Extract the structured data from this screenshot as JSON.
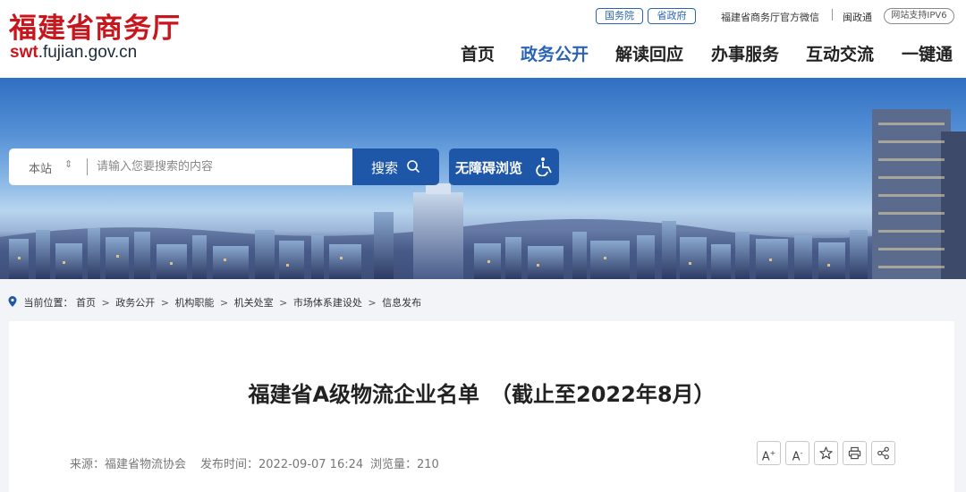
{
  "header": {
    "logo_cn": "福建省商务厅",
    "logo_url_prefix": "swt",
    "logo_url_suffix": ".fujian.gov.cn",
    "links": {
      "state_council": "国务院",
      "province_gov": "省政府",
      "wechat": "福建省商务厅官方微信",
      "minzhengtong": "闽政通",
      "ipv6": "网站支持IPV6"
    },
    "nav": [
      "首页",
      "政务公开",
      "解读回应",
      "办事服务",
      "互动交流",
      "一键通"
    ],
    "active_nav": "政务公开"
  },
  "search": {
    "scope": "本站",
    "placeholder": "请输入您要搜索的内容",
    "button": "搜索",
    "accessibility": "无障碍浏览"
  },
  "breadcrumb": {
    "label": "当前位置：",
    "items": [
      "首页",
      "政务公开",
      "机构职能",
      "机关处室",
      "市场体系建设处",
      "信息发布"
    ]
  },
  "article": {
    "title": "福建省A级物流企业名单　（截止至2022年8月）",
    "source": "来源：福建省物流协会",
    "publish_time": "发布时间：2022-09-07 16:24",
    "views": "浏览量：210"
  },
  "tools": {
    "font_up": "A",
    "font_up_sup": "+",
    "font_down": "A",
    "font_down_sup": "-"
  },
  "colors": {
    "brand_red": "#c8161d",
    "nav_blue": "#2b64b4",
    "button_blue": "#1f57a8"
  }
}
